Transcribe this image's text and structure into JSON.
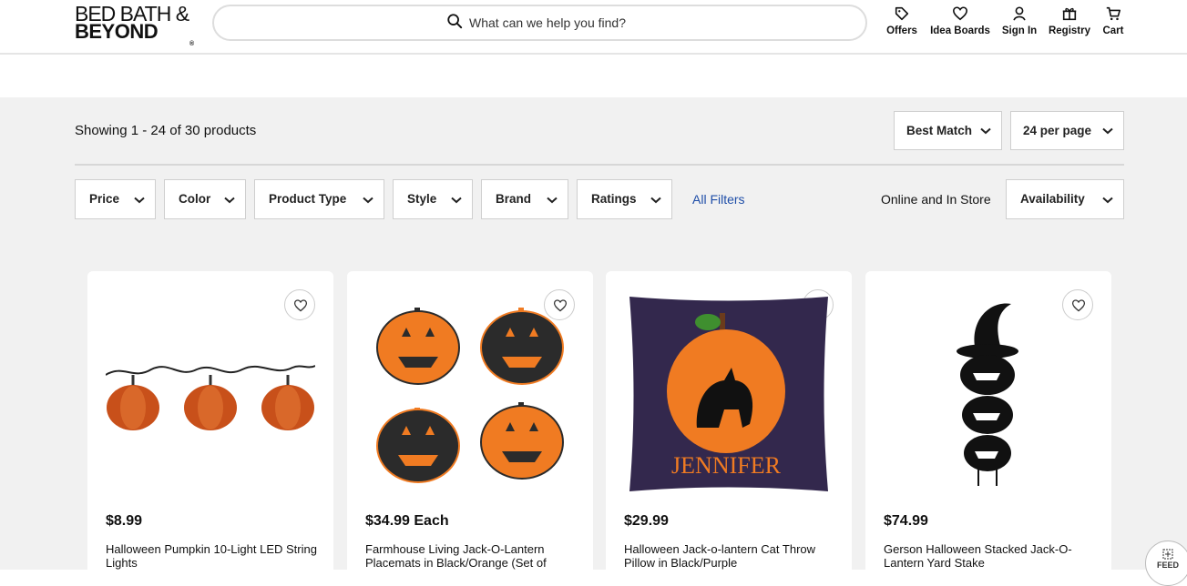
{
  "header": {
    "logo_line1": "BED BATH &",
    "logo_line2": "BEYOND",
    "logo_mark": "®",
    "search_placeholder": "What can we help you find?",
    "nav": [
      {
        "label": "Offers",
        "icon": "tag-icon"
      },
      {
        "label": "Idea Boards",
        "icon": "heart-icon"
      },
      {
        "label": "Sign In",
        "icon": "user-icon"
      },
      {
        "label": "Registry",
        "icon": "gift-icon"
      },
      {
        "label": "Cart",
        "icon": "cart-icon"
      }
    ]
  },
  "results": {
    "showing": "Showing 1 - 24 of 30 products",
    "sort": "Best Match",
    "per_page": "24 per page"
  },
  "filters": {
    "items": [
      "Price",
      "Color",
      "Product Type",
      "Style",
      "Brand",
      "Ratings"
    ],
    "all_filters": "All Filters",
    "online_label": "Online and In Store",
    "availability": "Availability"
  },
  "products": [
    {
      "price": "$8.99",
      "name": "Halloween Pumpkin 10-Light LED String Lights"
    },
    {
      "price": "$34.99 Each",
      "name": "Farmhouse Living Jack-O-Lantern Placemats in Black/Orange (Set of"
    },
    {
      "price": "$29.99",
      "name": "Halloween Jack-o-lantern Cat Throw Pillow in Black/Purple",
      "image_text": "JENNIFER"
    },
    {
      "price": "$74.99",
      "name": "Gerson Halloween Stacked Jack-O-Lantern Yard Stake"
    }
  ],
  "feedback": "FEED",
  "colors": {
    "accent_link": "#1f4ea8",
    "band": "#f1f1f1",
    "pumpkin": "#f07b22"
  }
}
